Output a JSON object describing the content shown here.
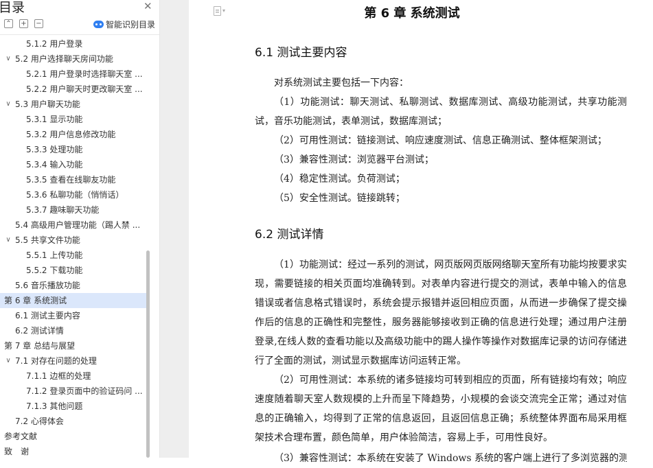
{
  "nav": {
    "title": "目录",
    "smart_label": "智能识别目录",
    "items": [
      {
        "text": "5.1.2 用户登录",
        "level": 3
      },
      {
        "text": "5.2 用户选择聊天房间功能",
        "level": 2,
        "expand": true
      },
      {
        "text": "5.2.1 用户登录时选择聊天室 ...",
        "level": 3
      },
      {
        "text": "5.2.2 用户聊天时更改聊天室 ...",
        "level": 3
      },
      {
        "text": "5.3 用户聊天功能",
        "level": 2,
        "expand": true
      },
      {
        "text": "5.3.1 显示功能",
        "level": 3
      },
      {
        "text": "5.3.2 用户信息修改功能",
        "level": 3
      },
      {
        "text": "5.3.3 处理功能",
        "level": 3
      },
      {
        "text": "5.3.4 输入功能",
        "level": 3
      },
      {
        "text": "5.3.5 查看在线聊友功能",
        "level": 3
      },
      {
        "text": "5.3.6 私聊功能（悄悄话）",
        "level": 3
      },
      {
        "text": "5.3.7 趣味聊天功能",
        "level": 3
      },
      {
        "text": "5.4 高级用户管理功能（踢人禁 ...",
        "level": 2
      },
      {
        "text": "5.5 共享文件功能",
        "level": 2,
        "expand": true
      },
      {
        "text": "5.5.1 上传功能",
        "level": 3
      },
      {
        "text": "5.5.2 下载功能",
        "level": 3
      },
      {
        "text": "5.6 音乐播放功能",
        "level": 2
      },
      {
        "text": "第 6 章  系统测试",
        "level": 1,
        "active": true
      },
      {
        "text": "6.1 测试主要内容",
        "level": 2
      },
      {
        "text": "6.2 测试详情",
        "level": 2
      },
      {
        "text": "第 7 章  总结与展望",
        "level": 1
      },
      {
        "text": "7.1 对存在问题的处理",
        "level": 2,
        "expand": true
      },
      {
        "text": "7.1.1 边框的处理",
        "level": 3
      },
      {
        "text": "7.1.2 登录页面中的验证码问 ...",
        "level": 3
      },
      {
        "text": "7.1.3 其他问题",
        "level": 3
      },
      {
        "text": "7.2 心得体会",
        "level": 2
      },
      {
        "text": "参考文献",
        "level": 1
      },
      {
        "text": "致　谢",
        "level": 1
      }
    ]
  },
  "doc": {
    "chapter": "第 6 章  系统测试",
    "sec1": "6.1 测试主要内容",
    "sec1_paras": [
      "对系统测试主要包括一下内容：",
      "（1）功能测试：聊天测试、私聊测试、数据库测试、高级功能测试，共享功能测试，音乐功能测试，表单测试，数据库测试；",
      "（2）可用性测试：链接测试、响应速度测试、信息正确测试、整体框架测试；",
      "（3）兼容性测试：浏览器平台测试；",
      "（4）稳定性测试。负荷测试；",
      "（5）安全性测试。链接跳转；"
    ],
    "sec2": "6.2 测试详情",
    "sec2_paras": [
      "（1）功能测试：经过一系列的测试，网页版网页版网络聊天室所有功能均按要求实现，需要链接的相关页面均准确转到。对表单内容进行提交的测试，表单中输入的信息错误或者信息格式错误时，系统会提示报错并返回相应页面，从而进一步确保了提交操作后的信息的正确性和完整性，服务器能够接收到正确的信息进行处理；通过用户注册登录,在线人数的查看功能以及高级功能中的踢人操作等操作对数据库记录的访问存储进行了全面的测试，测试显示数据库访问运转正常。",
      "（2）可用性测试：本系统的诸多链接均可转到相应的页面，所有链接均有效；响应速度随着聊天室人数规模的上升而呈下降趋势，小规模的会谈交流完全正常；通过对信息的正确输入，均得到了正常的信息返回，且返回信息正确；系统整体界面布局采用框架技术合理布置，颜色简单，用户体验简洁，容易上手，可用性良好。",
      "（3）兼容性测试：本系统在安装了 Windows 系统的客户端上进行了多浏览器的测"
    ]
  }
}
